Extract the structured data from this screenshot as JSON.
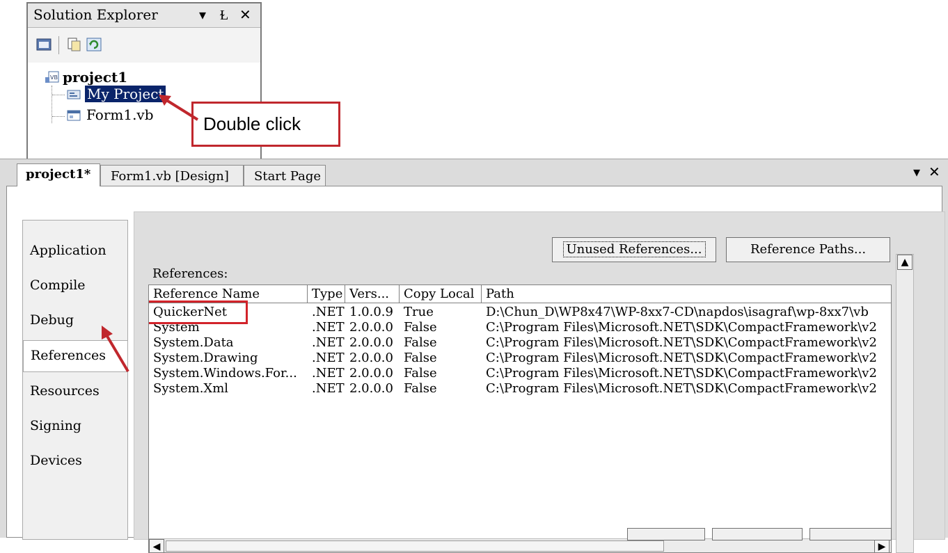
{
  "solution_explorer": {
    "title": "Solution Explorer",
    "controls": {
      "dropdown": "▾",
      "pin": "Ɫ",
      "close": "✕"
    },
    "toolbar_icons": [
      "properties-icon",
      "show-all-files-icon",
      "refresh-icon"
    ],
    "project_name": "project1",
    "items": [
      "My Project",
      "Form1.vb"
    ]
  },
  "callout": {
    "text": "Double click"
  },
  "document_tabs": [
    {
      "label": "project1*",
      "active": true
    },
    {
      "label": "Form1.vb [Design]",
      "active": false
    },
    {
      "label": "Start Page",
      "active": false
    }
  ],
  "window_controls": {
    "dropdown": "▾",
    "close": "✕"
  },
  "side_tabs": [
    "Application",
    "Compile",
    "Debug",
    "References",
    "Resources",
    "Signing",
    "Devices"
  ],
  "active_side_tab": "References",
  "references_panel": {
    "label": "References:",
    "unused_button": "Unused References...",
    "paths_button": "Reference Paths...",
    "columns": [
      "Reference Name",
      "Type",
      "Vers...",
      "Copy Local",
      "Path"
    ],
    "rows": [
      [
        "QuickerNet",
        ".NET",
        "1.0.0.9",
        "True",
        "D:\\Chun_D\\WP8x47\\WP-8xx7-CD\\napdos\\isagraf\\wp-8xx7\\vb"
      ],
      [
        "System",
        ".NET",
        "2.0.0.0",
        "False",
        "C:\\Program Files\\Microsoft.NET\\SDK\\CompactFramework\\v2"
      ],
      [
        "System.Data",
        ".NET",
        "2.0.0.0",
        "False",
        "C:\\Program Files\\Microsoft.NET\\SDK\\CompactFramework\\v2"
      ],
      [
        "System.Drawing",
        ".NET",
        "2.0.0.0",
        "False",
        "C:\\Program Files\\Microsoft.NET\\SDK\\CompactFramework\\v2"
      ],
      [
        "System.Windows.For...",
        ".NET",
        "2.0.0.0",
        "False",
        "C:\\Program Files\\Microsoft.NET\\SDK\\CompactFramework\\v2"
      ],
      [
        "System.Xml",
        ".NET",
        "2.0.0.0",
        "False",
        "C:\\Program Files\\Microsoft.NET\\SDK\\CompactFramework\\v2"
      ]
    ]
  },
  "colors": {
    "annotation_red": "#c0272d",
    "selection_blue": "#0a246a"
  }
}
